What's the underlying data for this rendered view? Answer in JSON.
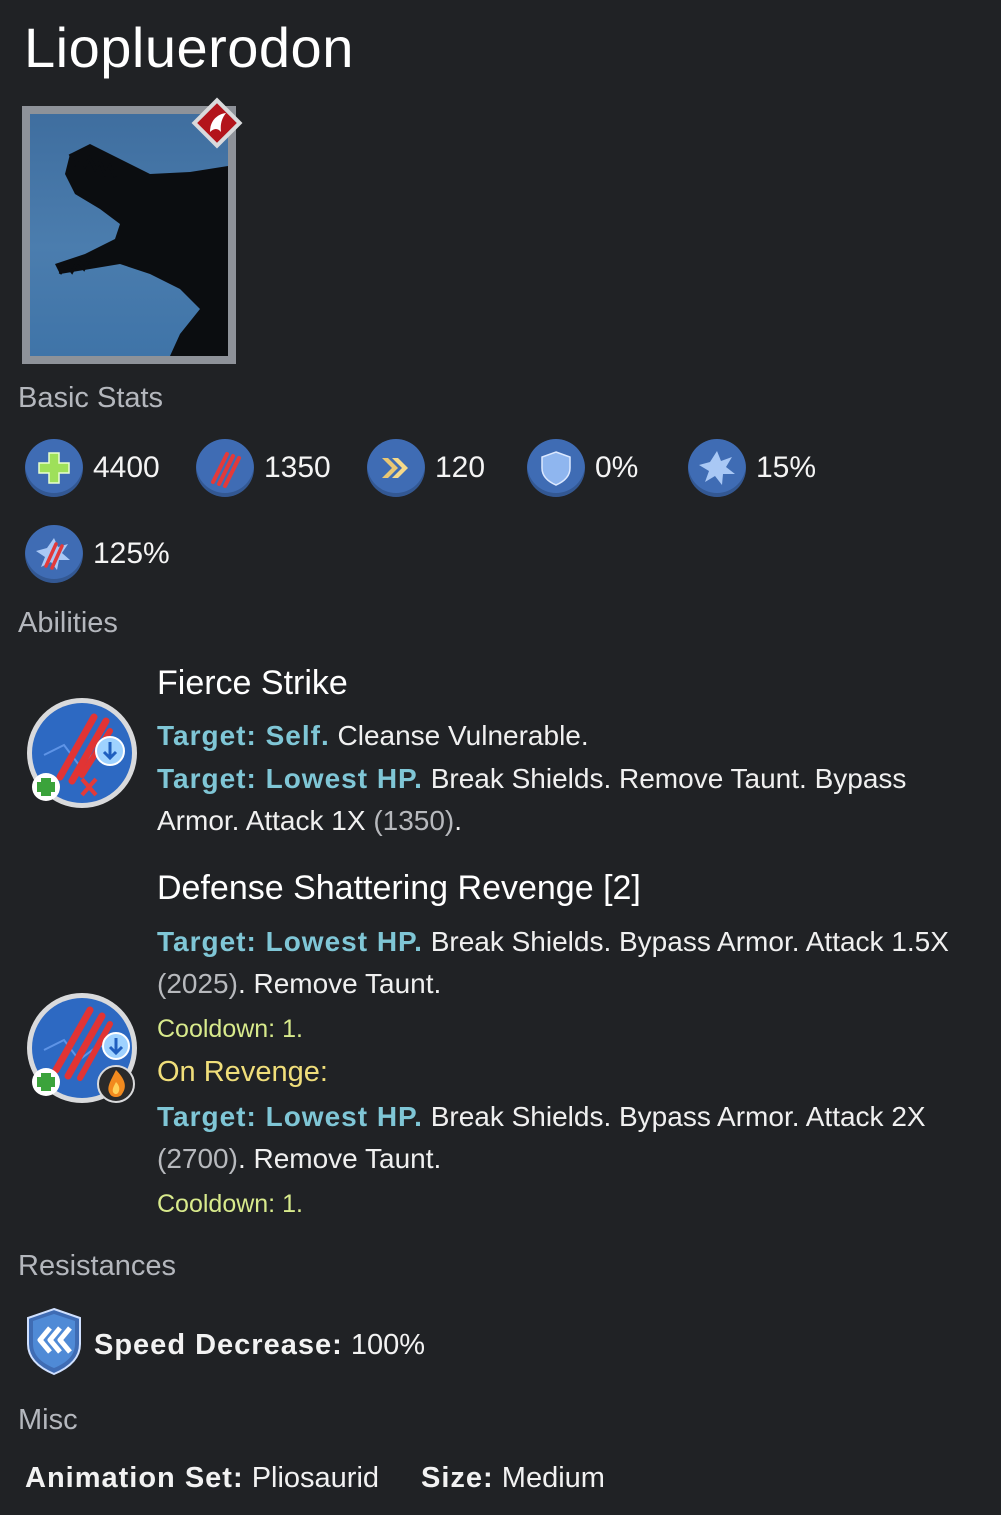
{
  "title": "Liopluerodon",
  "sections": {
    "basic_stats": "Basic Stats",
    "abilities": "Abilities",
    "resistances": "Resistances",
    "misc": "Misc"
  },
  "stats": [
    {
      "icon": "health-icon",
      "value": "4400"
    },
    {
      "icon": "damage-claw-icon",
      "value": "1350"
    },
    {
      "icon": "speed-chevron-icon",
      "value": "120"
    },
    {
      "icon": "armor-shield-icon",
      "value": "0%"
    },
    {
      "icon": "critical-burst-icon",
      "value": "15%"
    },
    {
      "icon": "critical-damage-icon",
      "value": "125%"
    }
  ],
  "abilities": [
    {
      "name": "Fierce Strike",
      "l1_target": "Target: Self.",
      "l1_text": "Cleanse Vulnerable.",
      "l2_target": "Target: Lowest HP.",
      "l2_text": "Break Shields. Remove Taunt. Bypass",
      "l3_text": "Armor. Attack 1X",
      "l3_paren": "(1350)",
      "l3_end": "."
    },
    {
      "name": "Defense Shattering Revenge [2]",
      "l1_target": "Target: Lowest HP.",
      "l1_text": "Break Shields. Bypass Armor. Attack 1.5X",
      "l2_paren": "(2025)",
      "l2_text": ". Remove Taunt.",
      "cooldown1": "Cooldown: 1.",
      "on_revenge": "On Revenge:",
      "r1_target": "Target: Lowest HP.",
      "r1_text": "Break Shields. Bypass Armor. Attack 2X",
      "r2_paren": "(2700)",
      "r2_text": ". Remove Taunt.",
      "cooldown2": "Cooldown: 1."
    }
  ],
  "resistance": {
    "label": "Speed Decrease:",
    "value": "100%"
  },
  "misc": {
    "animation_label": "Animation Set:",
    "animation_value": "Pliosaurid",
    "size_label": "Size:",
    "size_value": "Medium"
  },
  "colors": {
    "background": "#202225",
    "target_text": "#7fc6d6",
    "cooldown": "#d8ea8c",
    "revenge": "#f0de7a",
    "stat_icon_bg": "#3f6cb4"
  }
}
